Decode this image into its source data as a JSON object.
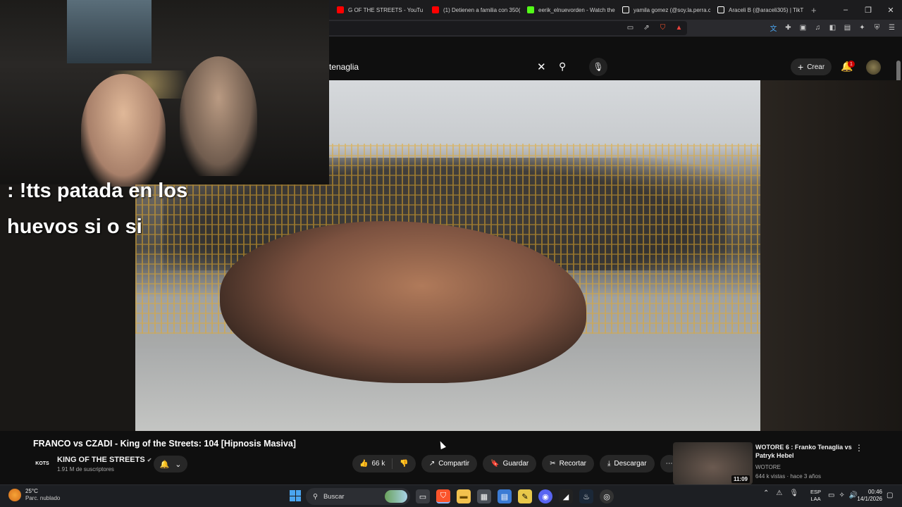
{
  "browser": {
    "tabs": [
      {
        "label": "G OF THE STREETS - YouTu",
        "color": "#ff0000"
      },
      {
        "label": "(1) Detienen a familia con 350(",
        "color": "#ff0000"
      },
      {
        "label": "eerik_elnuevorden - Watch the",
        "color": "#53fc18"
      },
      {
        "label": "yamila gomez (@soy.la.perra.c",
        "color": "#ffffff"
      },
      {
        "label": "Araceli B (@araceli305) | TikT",
        "color": "#ffffff"
      }
    ],
    "new_tab": "+",
    "controls": [
      "–",
      "❐",
      "✕"
    ]
  },
  "youtube": {
    "search_query": "tenaglia",
    "create_label": "Crear",
    "notification_count": "1"
  },
  "stream_overlay": {
    "tts_line1": ": !tts patada en los",
    "tts_line2": "huevos si o si"
  },
  "video": {
    "title": "FRANCO vs CZADI - King of the Streets: 104 [Hipnosis Masiva]",
    "channel_logo_text": "KOTS",
    "channel_name": "KING OF THE STREETS",
    "subscribers": "1.91 M de suscriptores",
    "likes": "66 k",
    "share_label": "Compartir",
    "save_label": "Guardar",
    "clip_label": "Recortar",
    "download_label": "Descargar"
  },
  "recommendation": {
    "title": "WOTORE 6 : Franko Tenaglia vs Patryk Hebel",
    "channel": "WOTORE",
    "meta": "644 k vistas · hace 3 años",
    "duration": "11:09"
  },
  "taskbar": {
    "temperature": "25°C",
    "weather": "Parc. nublado",
    "search_label": "Buscar",
    "lang_line1": "ESP",
    "lang_line2": "LAA",
    "time": "00:46",
    "date": "14/1/2026"
  }
}
